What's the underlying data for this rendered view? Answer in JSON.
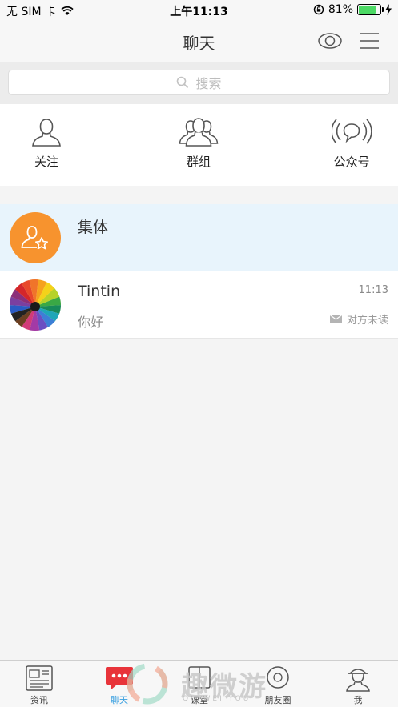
{
  "status_bar": {
    "carrier": "无 SIM 卡",
    "time": "上午11:13",
    "battery_percent": "81%",
    "battery_level": 0.81
  },
  "nav": {
    "title": "聊天"
  },
  "search": {
    "placeholder": "搜索"
  },
  "shortcuts": [
    {
      "label": "关注",
      "icon": "person-icon"
    },
    {
      "label": "群组",
      "icon": "group-icon"
    },
    {
      "label": "公众号",
      "icon": "broadcast-icon"
    }
  ],
  "chats": [
    {
      "name": "集体",
      "message": "",
      "time": "",
      "status": "",
      "avatar": "group-star-avatar",
      "highlighted": true
    },
    {
      "name": "Tintin",
      "message": "你好",
      "time": "11:13",
      "status": "对方未读",
      "avatar": "colored-pencils-avatar",
      "highlighted": false
    }
  ],
  "tabs": [
    {
      "label": "资讯",
      "icon": "news-icon",
      "active": false
    },
    {
      "label": "聊天",
      "icon": "chat-icon",
      "active": true
    },
    {
      "label": "课堂",
      "icon": "classroom-icon",
      "active": false
    },
    {
      "label": "朋友圈",
      "icon": "moments-icon",
      "active": false
    },
    {
      "label": "我",
      "icon": "profile-icon",
      "active": false
    }
  ],
  "watermark": {
    "text": "趣微游",
    "sub": "QU WEI YOU"
  },
  "colors": {
    "accent": "#3aa0e0",
    "highlight_row": "#e8f4fc",
    "group_avatar": "#f7932e",
    "badge_red": "#e8343a"
  }
}
